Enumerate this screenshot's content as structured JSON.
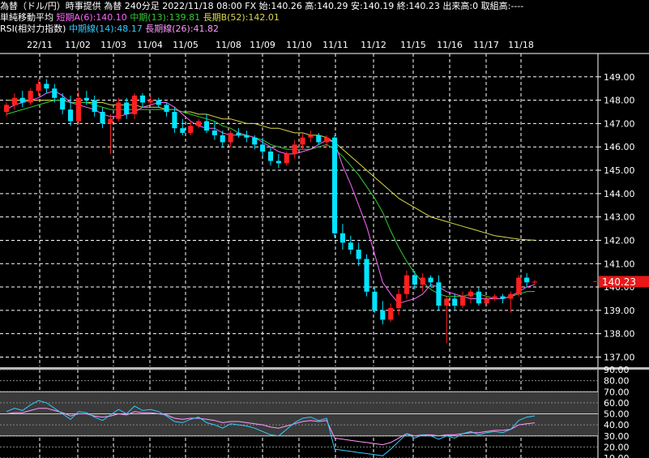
{
  "header": {
    "line1": "為替（ドル/円）時事提供 為替 240分足 2022/11/18 08:00 FX 始:140.26 高:140.29 安:140.19 終:140.23 出来高:0 取組高:----",
    "ma_label": "単純移動平均",
    "ma_short": "短期A(6):140.10",
    "ma_mid": "中期(13):139.81",
    "ma_long": "長期B(52):142.01",
    "rsi_label": "RSI(相対力指数)",
    "rsi_mid": "中期線(14):48.17",
    "rsi_long": "長期線(26):41.82"
  },
  "colors": {
    "bg": "#000000",
    "up": "#ff2020",
    "down": "#00e5ff",
    "ma_short": "#ff66ff",
    "ma_mid": "#33cc33",
    "ma_long": "#d8d84a",
    "rsi_mid": "#33ccff",
    "rsi_long": "#ff99ff",
    "grid": "#ffffff",
    "last_bg": "#e81818"
  },
  "chart_data": [
    {
      "type": "candlestick",
      "x_labels": [
        "22/11",
        "11/02",
        "11/03",
        "11/04",
        "11/05",
        "11/08",
        "11/09",
        "11/10",
        "11/11",
        "11/12",
        "11/15",
        "11/16",
        "11/17",
        "11/18"
      ],
      "ylim": [
        136.6,
        150.0
      ],
      "y_ticks": [
        137,
        138,
        139,
        140,
        141,
        142,
        143,
        144,
        145,
        146,
        147,
        148,
        149
      ],
      "y_tick_labels": [
        "137.00",
        "138.00",
        "139.00",
        "140.00",
        "141.00",
        "142.00",
        "143.00",
        "144.00",
        "145.00",
        "146.00",
        "147.00",
        "148.00",
        "149.00"
      ],
      "last_price_label": "140.23",
      "last_price": 140.23,
      "ohlc": [
        [
          147.5,
          147.9,
          147.3,
          147.8
        ],
        [
          147.8,
          148.3,
          147.6,
          148.1
        ],
        [
          148.1,
          148.4,
          147.7,
          147.9
        ],
        [
          147.9,
          148.5,
          147.8,
          148.4
        ],
        [
          148.4,
          148.9,
          148.2,
          148.7
        ],
        [
          148.7,
          148.9,
          148.3,
          148.5
        ],
        [
          148.5,
          148.7,
          147.9,
          148.1
        ],
        [
          148.1,
          148.3,
          147.4,
          147.6
        ],
        [
          147.6,
          148.2,
          146.9,
          147.1
        ],
        [
          147.1,
          148.4,
          147.0,
          148.1
        ],
        [
          148.1,
          148.4,
          147.8,
          148.0
        ],
        [
          148.0,
          148.2,
          147.3,
          147.5
        ],
        [
          147.5,
          147.7,
          146.8,
          147.0
        ],
        [
          147.0,
          147.4,
          145.7,
          147.2
        ],
        [
          147.2,
          148.1,
          147.1,
          147.9
        ],
        [
          147.9,
          148.1,
          147.2,
          147.4
        ],
        [
          147.4,
          148.3,
          147.2,
          148.2
        ],
        [
          148.2,
          148.3,
          147.7,
          147.9
        ],
        [
          147.9,
          148.2,
          147.8,
          148.0
        ],
        [
          148.0,
          148.1,
          147.7,
          147.8
        ],
        [
          147.8,
          147.9,
          147.3,
          147.5
        ],
        [
          147.5,
          147.7,
          146.6,
          146.8
        ],
        [
          146.8,
          147.2,
          146.5,
          146.6
        ],
        [
          146.6,
          147.1,
          146.5,
          146.9
        ],
        [
          146.9,
          147.2,
          146.8,
          147.1
        ],
        [
          147.1,
          147.4,
          146.6,
          146.7
        ],
        [
          146.7,
          147.1,
          146.3,
          146.5
        ],
        [
          146.5,
          146.7,
          146.0,
          146.2
        ],
        [
          146.2,
          146.7,
          146.0,
          146.6
        ],
        [
          146.6,
          146.8,
          146.4,
          146.5
        ],
        [
          146.5,
          146.7,
          146.2,
          146.4
        ],
        [
          146.4,
          146.5,
          145.9,
          146.1
        ],
        [
          146.1,
          146.4,
          145.6,
          145.8
        ],
        [
          145.8,
          146.0,
          145.2,
          145.4
        ],
        [
          145.4,
          145.7,
          145.1,
          145.3
        ],
        [
          145.3,
          145.8,
          145.2,
          145.7
        ],
        [
          145.7,
          146.3,
          145.5,
          146.1
        ],
        [
          146.1,
          146.6,
          145.9,
          146.4
        ],
        [
          146.4,
          146.7,
          146.2,
          146.5
        ],
        [
          146.5,
          146.6,
          146.1,
          146.2
        ],
        [
          146.2,
          146.5,
          146.0,
          146.4
        ],
        [
          146.4,
          146.5,
          142.1,
          142.3
        ],
        [
          142.3,
          142.7,
          141.6,
          141.9
        ],
        [
          141.9,
          142.2,
          141.4,
          141.6
        ],
        [
          141.6,
          141.9,
          140.9,
          141.2
        ],
        [
          141.2,
          141.4,
          139.6,
          139.8
        ],
        [
          139.8,
          140.0,
          138.9,
          139.0
        ],
        [
          139.0,
          139.4,
          138.4,
          138.6
        ],
        [
          138.6,
          139.3,
          138.5,
          139.1
        ],
        [
          139.1,
          139.9,
          138.8,
          139.7
        ],
        [
          139.7,
          140.7,
          139.5,
          140.5
        ],
        [
          140.5,
          140.7,
          139.9,
          140.1
        ],
        [
          140.1,
          140.6,
          139.8,
          140.4
        ],
        [
          140.4,
          140.5,
          140.0,
          140.2
        ],
        [
          140.2,
          140.5,
          139.0,
          139.2
        ],
        [
          139.2,
          139.6,
          137.6,
          139.5
        ],
        [
          139.5,
          139.7,
          139.0,
          139.2
        ],
        [
          139.2,
          139.8,
          139.1,
          139.6
        ],
        [
          139.6,
          139.9,
          139.3,
          139.8
        ],
        [
          139.8,
          140.0,
          139.2,
          139.3
        ],
        [
          139.3,
          139.6,
          139.2,
          139.5
        ],
        [
          139.5,
          139.7,
          139.4,
          139.6
        ],
        [
          139.6,
          139.7,
          139.3,
          139.5
        ],
        [
          139.5,
          139.8,
          138.9,
          139.7
        ],
        [
          139.7,
          140.5,
          139.6,
          140.4
        ],
        [
          140.4,
          140.6,
          140.0,
          140.2
        ],
        [
          140.2,
          140.3,
          140.1,
          140.23
        ]
      ],
      "ma_short": [
        147.6,
        147.8,
        147.9,
        148.0,
        148.1,
        148.3,
        148.4,
        148.2,
        147.9,
        147.8,
        147.7,
        147.6,
        147.4,
        147.3,
        147.3,
        147.4,
        147.5,
        147.7,
        147.8,
        147.9,
        147.9,
        147.7,
        147.4,
        147.1,
        146.9,
        146.8,
        146.8,
        146.6,
        146.5,
        146.5,
        146.5,
        146.4,
        146.2,
        146.0,
        145.8,
        145.7,
        145.7,
        145.8,
        145.9,
        146.1,
        146.3,
        146.2,
        145.2,
        144.4,
        143.5,
        142.6,
        141.4,
        140.2,
        139.7,
        139.3,
        139.4,
        139.5,
        139.7,
        140.1,
        140.0,
        139.8,
        139.7,
        139.6,
        139.5,
        139.5,
        139.5,
        139.5,
        139.5,
        139.6,
        139.8,
        140.0,
        140.1
      ],
      "ma_mid": [
        147.4,
        147.5,
        147.6,
        147.7,
        147.8,
        147.9,
        148.0,
        148.0,
        147.9,
        147.9,
        147.9,
        147.8,
        147.7,
        147.6,
        147.6,
        147.6,
        147.6,
        147.6,
        147.6,
        147.6,
        147.6,
        147.6,
        147.5,
        147.4,
        147.3,
        147.2,
        147.1,
        146.9,
        146.8,
        146.6,
        146.5,
        146.4,
        146.3,
        146.1,
        146.0,
        145.9,
        145.9,
        145.9,
        145.9,
        146.0,
        146.1,
        145.9,
        145.6,
        145.2,
        144.8,
        144.3,
        143.8,
        143.2,
        142.4,
        141.7,
        141.1,
        140.6,
        140.2,
        139.9,
        139.7,
        139.6,
        139.6,
        139.6,
        139.7,
        139.7,
        139.6,
        139.5,
        139.5,
        139.6,
        139.7,
        139.8,
        139.81
      ],
      "ma_long": [
        148.0,
        148.0,
        148.0,
        148.0,
        148.0,
        148.0,
        148.0,
        148.0,
        147.9,
        147.9,
        147.9,
        147.9,
        147.9,
        147.8,
        147.8,
        147.8,
        147.8,
        147.7,
        147.7,
        147.7,
        147.6,
        147.6,
        147.5,
        147.5,
        147.4,
        147.4,
        147.3,
        147.2,
        147.2,
        147.1,
        147.0,
        147.0,
        146.9,
        146.8,
        146.8,
        146.7,
        146.6,
        146.6,
        146.5,
        146.5,
        146.4,
        146.2,
        145.9,
        145.6,
        145.3,
        145.0,
        144.7,
        144.4,
        144.1,
        143.8,
        143.6,
        143.4,
        143.2,
        143.0,
        142.9,
        142.8,
        142.7,
        142.6,
        142.5,
        142.4,
        142.3,
        142.2,
        142.15,
        142.1,
        142.05,
        142.02,
        142.01
      ]
    },
    {
      "type": "line",
      "name": "RSI",
      "ylim": [
        10,
        90
      ],
      "y_ticks": [
        10,
        20,
        30,
        40,
        50,
        60,
        70,
        80,
        90
      ],
      "y_tick_labels": [
        "10.00",
        "20.00",
        "30.00",
        "40.00",
        "50.00",
        "60.00",
        "70.00",
        "80.00",
        "90.00"
      ],
      "rsi_mid": [
        52,
        55,
        53,
        58,
        62,
        60,
        55,
        50,
        45,
        52,
        51,
        47,
        44,
        49,
        54,
        50,
        57,
        53,
        54,
        52,
        48,
        43,
        42,
        45,
        47,
        42,
        40,
        37,
        41,
        40,
        39,
        37,
        34,
        31,
        30,
        36,
        42,
        46,
        47,
        44,
        46,
        18,
        17,
        16,
        15,
        14,
        13,
        12,
        18,
        25,
        32,
        28,
        31,
        30,
        27,
        30,
        28,
        32,
        34,
        31,
        33,
        34,
        33,
        36,
        44,
        47,
        48.17
      ],
      "rsi_long": [
        50,
        51,
        51,
        53,
        55,
        55,
        53,
        51,
        48,
        50,
        50,
        48,
        47,
        48,
        50,
        49,
        52,
        51,
        51,
        50,
        49,
        46,
        45,
        46,
        46,
        45,
        44,
        42,
        43,
        43,
        42,
        41,
        40,
        38,
        37,
        39,
        41,
        43,
        44,
        43,
        44,
        28,
        27,
        26,
        25,
        24,
        23,
        22,
        24,
        28,
        32,
        30,
        31,
        31,
        30,
        31,
        31,
        32,
        33,
        33,
        34,
        35,
        35,
        36,
        40,
        41,
        41.82
      ]
    }
  ]
}
